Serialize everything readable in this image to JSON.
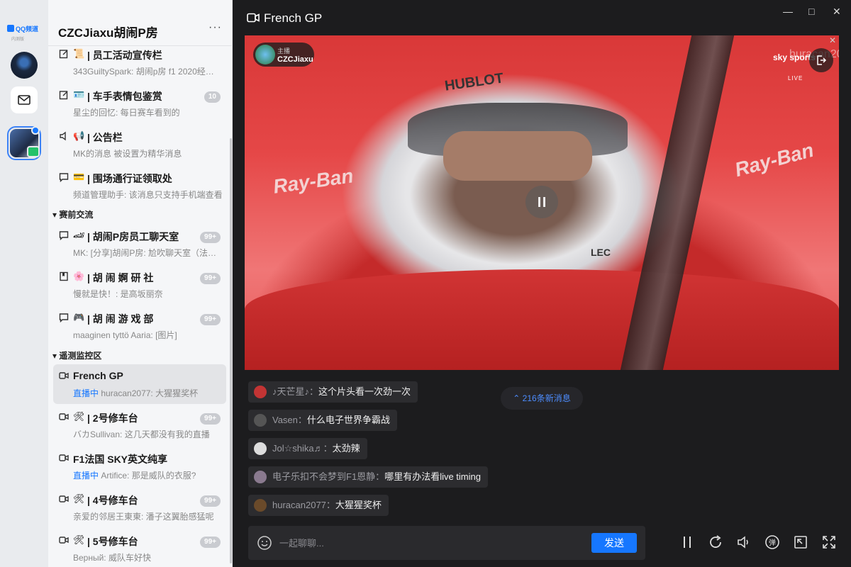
{
  "rail": {
    "logo_text": "QQ频道",
    "logo_sub": "内测版"
  },
  "sidebar": {
    "guild_name": "CZCJiaxu胡闹P房",
    "more": "···",
    "channels_top": [
      {
        "icon": "edit-icon",
        "emoji": "📜",
        "title": "| 员工活动宣传栏",
        "sub": "343GuiltySpark: 胡闹p房 f1 2020经…",
        "count": ""
      },
      {
        "icon": "edit-icon",
        "emoji": "🪪",
        "title": "| 车手表情包鉴赏",
        "sub": "星尘的回忆: 每日赛车看到的",
        "count": "10"
      },
      {
        "icon": "speaker-icon",
        "emoji": "📢",
        "title": "| 公告栏",
        "sub": "MK的消息 被设置为精华消息",
        "count": ""
      },
      {
        "icon": "chat-icon",
        "emoji": "💳",
        "title": "| 围场通行证领取处",
        "sub": "频道管理助手: 该消息只支持手机端查看",
        "count": ""
      }
    ],
    "section1": "赛前交流",
    "channels_mid": [
      {
        "icon": "chat-icon",
        "emoji": "🏎",
        "title": "| 胡闹P房员工聊天室",
        "sub": "MK: [分享]胡闹P房: 尬吹聊天室（法…",
        "count": "99+"
      },
      {
        "icon": "book-icon",
        "emoji": "🌸",
        "title": "| 胡 闹 婀 研 社",
        "sub": "慢就是快！: 是高坂丽奈",
        "count": "99+"
      },
      {
        "icon": "chat-icon",
        "emoji": "🎮",
        "title": "| 胡 闹 游 戏 部",
        "sub": "maaginen tyttö Aaria: [图片]",
        "count": "99+"
      }
    ],
    "section2": "遥测监控区",
    "channels_bottom": [
      {
        "icon": "video-icon",
        "emoji": "",
        "title": "French GP",
        "live": "直播中",
        "sub": "huracan2077: 大猩猩奖杯",
        "count": "",
        "selected": true
      },
      {
        "icon": "video-icon",
        "emoji": "🛠",
        "title": "| 2号修车台",
        "live": "",
        "sub": "バカSullivan: 这几天都没有我的直播",
        "count": "99+"
      },
      {
        "icon": "video-icon",
        "emoji": "",
        "title": "F1法国 SKY英文纯享",
        "live": "直播中",
        "sub": "Artifice: 那是威队的衣服?",
        "count": ""
      },
      {
        "icon": "video-icon",
        "emoji": "🛠",
        "title": "| 4号修车台",
        "live": "",
        "sub": "亲爱的邻居王東東: 潘子这翼胎感猛呢",
        "count": "99+"
      },
      {
        "icon": "video-icon",
        "emoji": "🛠",
        "title": "| 5号修车台",
        "live": "",
        "sub": "Верный: 威队车好快",
        "count": "99+"
      }
    ]
  },
  "main": {
    "title": "French GP",
    "host_label": "主播",
    "host_name": "CZCJiaxu",
    "video_texts": {
      "hublot": "HUBLOT",
      "rayban1": "Ray-Ban",
      "rayban2": "Ray-Ban",
      "lec": "LEC",
      "sky": "sky sports",
      "live": "LIVE",
      "hura": "huracan2077"
    },
    "new_messages": "216条新消息",
    "messages": [
      {
        "who": "♪天芒星♪",
        "text": "这个片头看一次劲一次",
        "color": "#c23434"
      },
      {
        "who": "Vasen",
        "text": "什么电子世界争霸战",
        "color": "#555"
      },
      {
        "who": "Jol☆shika♬",
        "text": "太劲辣",
        "color": "#ddd"
      },
      {
        "who": "电子乐扣不会梦到F1恩静",
        "text": "哪里有办法看live timing",
        "color": "#8a7a8f"
      },
      {
        "who": "huracan2077",
        "text": "大猩猩奖杯",
        "color": "#6a4a2a"
      }
    ],
    "input_placeholder": "一起聊聊...",
    "send_label": "发送"
  },
  "colors": {
    "accent": "#1677ff",
    "live": "#1677ff",
    "bg_dark": "#1c1c1e"
  }
}
